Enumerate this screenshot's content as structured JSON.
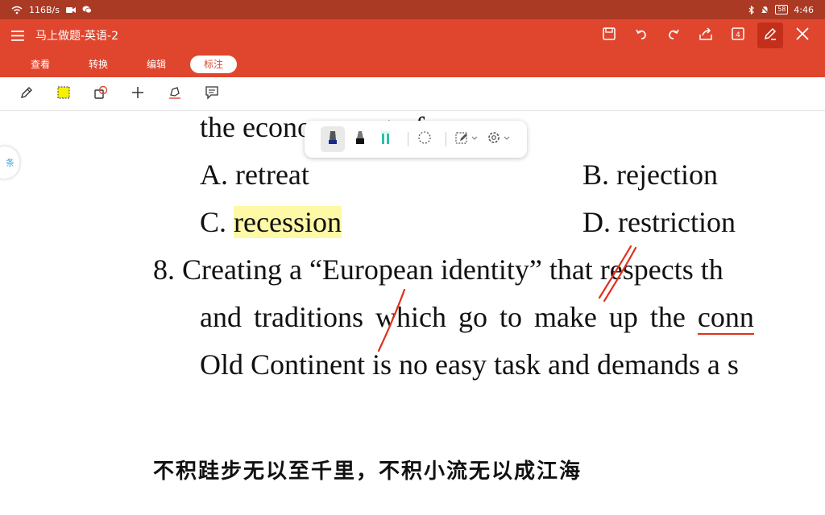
{
  "status_bar": {
    "speed": "116B/s",
    "battery": "58",
    "time": "4:46"
  },
  "app": {
    "title": "马上做题-英语-2"
  },
  "tabs": [
    {
      "label": "查看",
      "active": false
    },
    {
      "label": "转换",
      "active": false
    },
    {
      "label": "编辑",
      "active": false
    },
    {
      "label": "标注",
      "active": true
    }
  ],
  "toolbar": {
    "icons": [
      "pen-icon",
      "highlight-box-icon",
      "shapes-icon",
      "plus-icon",
      "signature-icon",
      "comment-icon"
    ]
  },
  "document": {
    "line1": "the economy out of",
    "line1_blank": ".",
    "option_a": "A. retreat",
    "option_b": "B. rejection",
    "option_c_prefix": "C. ",
    "option_c_word": "recession",
    "option_d": "D. restriction",
    "q8_line1": "8.  Creating a “European identity” that respects th",
    "q8_line2_a": "and traditions which go to make up the ",
    "q8_line2_b": "conn",
    "q8_line3": "Old Continent is no easy task and demands a s",
    "motto": "不积跬步无以至千里，不积小流无以成江海",
    "side_bubble": "条"
  },
  "colors": {
    "header": "#e0462e",
    "status": "#ab3a24",
    "highlight": "#fdf9a6",
    "ink": "#e0301e"
  }
}
